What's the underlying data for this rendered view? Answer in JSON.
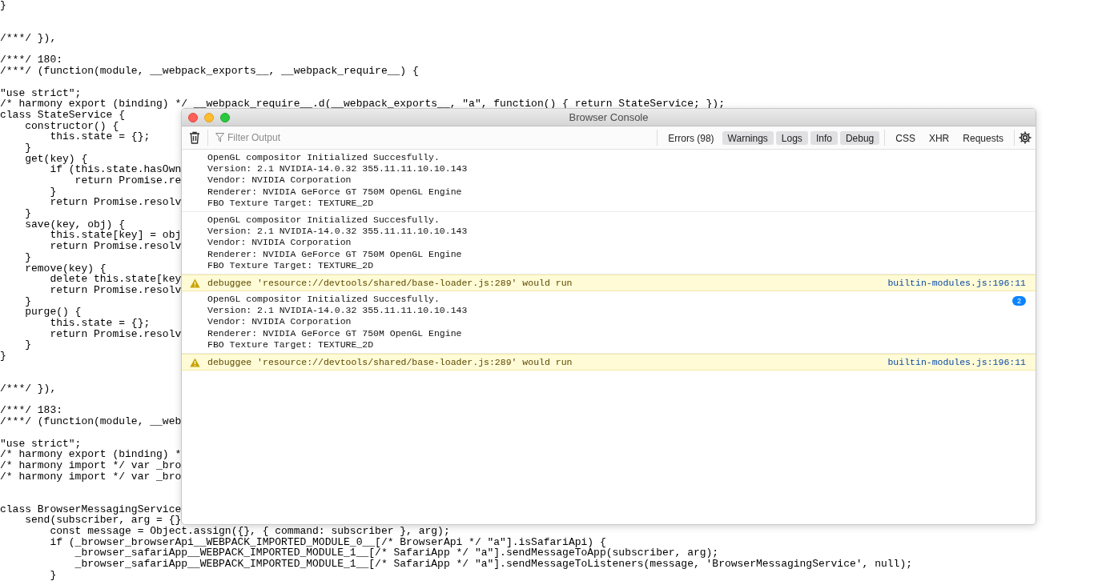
{
  "background_code": {
    "lines": [
      {
        "kind": "code",
        "text": "}"
      },
      {
        "kind": "blank"
      },
      {
        "kind": "blank"
      },
      {
        "kind": "code",
        "text": "/***/ }),"
      },
      {
        "kind": "blank"
      },
      {
        "kind": "code",
        "text": "/***/ 180:"
      },
      {
        "kind": "code",
        "text": "/***/ (function(module, __webpack_exports__, __webpack_require__) {"
      },
      {
        "kind": "blank"
      },
      {
        "kind": "code",
        "text": "\"use strict\";"
      },
      {
        "kind": "code",
        "text": "/* harmony export (binding) */ __webpack_require__.d(__webpack_exports__, \"a\", function() { return StateService; });"
      },
      {
        "kind": "code",
        "text": "class StateService {"
      },
      {
        "kind": "code",
        "text": "    constructor() {"
      },
      {
        "kind": "code",
        "text": "        this.state = {};"
      },
      {
        "kind": "code",
        "text": "    }"
      },
      {
        "kind": "code",
        "text": "    get(key) {"
      },
      {
        "kind": "code",
        "text": "        if (this.state.hasOwn"
      },
      {
        "kind": "code",
        "text": "            return Promise.re"
      },
      {
        "kind": "code",
        "text": "        }"
      },
      {
        "kind": "code",
        "text": "        return Promise.resolv"
      },
      {
        "kind": "code",
        "text": "    }"
      },
      {
        "kind": "code",
        "text": "    save(key, obj) {"
      },
      {
        "kind": "code",
        "text": "        this.state[key] = obj"
      },
      {
        "kind": "code",
        "text": "        return Promise.resolv"
      },
      {
        "kind": "code",
        "text": "    }"
      },
      {
        "kind": "code",
        "text": "    remove(key) {"
      },
      {
        "kind": "code",
        "text": "        delete this.state[key"
      },
      {
        "kind": "code",
        "text": "        return Promise.resolv"
      },
      {
        "kind": "code",
        "text": "    }"
      },
      {
        "kind": "code",
        "text": "    purge() {"
      },
      {
        "kind": "code",
        "text": "        this.state = {};"
      },
      {
        "kind": "code",
        "text": "        return Promise.resolv"
      },
      {
        "kind": "code",
        "text": "    }"
      },
      {
        "kind": "code",
        "text": "}"
      },
      {
        "kind": "blank"
      },
      {
        "kind": "blank"
      },
      {
        "kind": "code",
        "text": "/***/ }),"
      },
      {
        "kind": "blank"
      },
      {
        "kind": "code",
        "text": "/***/ 183:"
      },
      {
        "kind": "code",
        "text": "/***/ (function(module, __web"
      },
      {
        "kind": "blank"
      },
      {
        "kind": "code",
        "text": "\"use strict\";"
      },
      {
        "kind": "code",
        "text": "/* harmony export (binding) *"
      },
      {
        "kind": "code",
        "text": "/* harmony import */ var _bro"
      },
      {
        "kind": "code",
        "text": "/* harmony import */ var _bro"
      },
      {
        "kind": "blank"
      },
      {
        "kind": "blank"
      },
      {
        "kind": "code",
        "text": "class BrowserMessagingService"
      },
      {
        "kind": "code",
        "text": "    send(subscriber, arg = {}"
      },
      {
        "kind": "code",
        "text": "        const message = Object.assign({}, { command: subscriber }, arg);"
      },
      {
        "kind": "code",
        "text": "        if (_browser_browserApi__WEBPACK_IMPORTED_MODULE_0__[/* BrowserApi */ \"a\"].isSafariApi) {"
      },
      {
        "kind": "code",
        "text": "            _browser_safariApp__WEBPACK_IMPORTED_MODULE_1__[/* SafariApp */ \"a\"].sendMessageToApp(subscriber, arg);"
      },
      {
        "kind": "code",
        "text": "            _browser_safariApp__WEBPACK_IMPORTED_MODULE_1__[/* SafariApp */ \"a\"].sendMessageToListeners(message, 'BrowserMessagingService', null);"
      },
      {
        "kind": "code",
        "text": "        }"
      }
    ]
  },
  "console_window": {
    "title": "Browser Console",
    "filter": {
      "placeholder": "Filter Output"
    },
    "level_filters": [
      {
        "label": "Errors (98)",
        "selected": false
      },
      {
        "label": "Warnings",
        "selected": true
      },
      {
        "label": "Logs",
        "selected": true
      },
      {
        "label": "Info",
        "selected": true
      },
      {
        "label": "Debug",
        "selected": true
      }
    ],
    "request_filters": [
      {
        "label": "CSS",
        "selected": false
      },
      {
        "label": "XHR",
        "selected": false
      },
      {
        "label": "Requests",
        "selected": false
      }
    ],
    "messages": [
      {
        "kind": "log",
        "lines": [
          "OpenGL compositor Initialized Succesfully.",
          "Version: 2.1 NVIDIA-14.0.32 355.11.11.10.10.143",
          "Vendor: NVIDIA Corporation",
          "Renderer: NVIDIA GeForce GT 750M OpenGL Engine",
          "FBO Texture Target: TEXTURE_2D"
        ]
      },
      {
        "kind": "log",
        "lines": [
          "OpenGL compositor Initialized Succesfully.",
          "Version: 2.1 NVIDIA-14.0.32 355.11.11.10.10.143",
          "Vendor: NVIDIA Corporation",
          "Renderer: NVIDIA GeForce GT 750M OpenGL Engine",
          "FBO Texture Target: TEXTURE_2D"
        ]
      },
      {
        "kind": "warning",
        "text": "debuggee 'resource://devtools/shared/base-loader.js:289' would run",
        "source": "builtin-modules.js:196:11"
      },
      {
        "kind": "log",
        "lines": [
          "OpenGL compositor Initialized Succesfully.",
          "Version: 2.1 NVIDIA-14.0.32 355.11.11.10.10.143",
          "Vendor: NVIDIA Corporation",
          "Renderer: NVIDIA GeForce GT 750M OpenGL Engine",
          "FBO Texture Target: TEXTURE_2D"
        ],
        "repeat": "2"
      },
      {
        "kind": "warning",
        "text": "debuggee 'resource://devtools/shared/base-loader.js:289' would run",
        "source": "builtin-modules.js:196:11"
      }
    ]
  }
}
